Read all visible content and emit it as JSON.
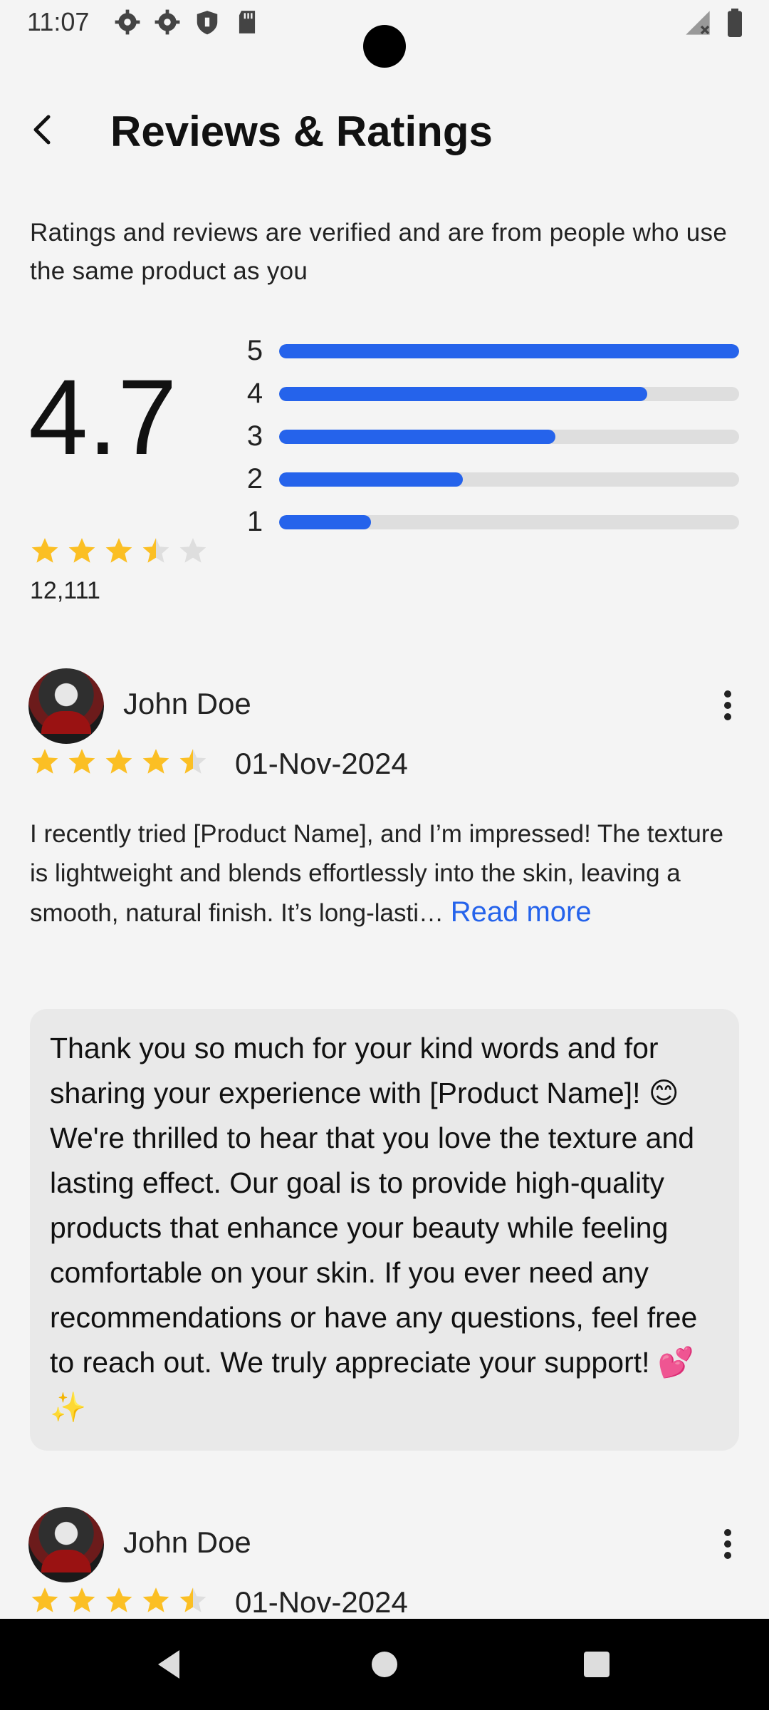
{
  "status_bar": {
    "time": "11:07",
    "icons": [
      "settings-icon",
      "settings-icon",
      "shield-icon",
      "sd-card-icon"
    ],
    "right_icons": [
      "signal-icon",
      "battery-icon"
    ]
  },
  "app_bar": {
    "back_icon": "back-arrow-icon",
    "title": "Reviews & Ratings"
  },
  "intro_text": "Ratings and reviews are verified and are from people who use the same product as you",
  "summary": {
    "average": "4.7",
    "total": "12,111",
    "stars_fraction": 3.5,
    "distribution": [
      {
        "label": "5",
        "fraction": 1.0
      },
      {
        "label": "4",
        "fraction": 0.8
      },
      {
        "label": "3",
        "fraction": 0.6
      },
      {
        "label": "2",
        "fraction": 0.4
      },
      {
        "label": "1",
        "fraction": 0.2
      }
    ],
    "bar_color": "#2563eb"
  },
  "reviews": [
    {
      "name": "John Doe",
      "date": "01-Nov-2024",
      "rating": 4.5,
      "text": "I recently tried [Product Name], and I’m impressed! The texture is lightweight and blends effortlessly into the skin, leaving a smooth, natural finish. It’s long-lasti…",
      "read_more": "Read more",
      "reply": "Thank you so much for your kind words and for sharing your experience with [Product Name]! 😊 We're thrilled to hear that you love the texture and lasting effect. Our goal is to provide high-quality products that enhance your beauty while feeling comfortable on your skin. If you ever need any recommendations or have any questions, feel free to reach out. We truly appreciate your support! 💕✨"
    },
    {
      "name": "John Doe",
      "date": "01-Nov-2024",
      "rating": 4.5
    }
  ],
  "colors": {
    "star": "#fbbf24",
    "star_empty": "#dedede",
    "accent": "#2563eb"
  },
  "nav_bar": [
    "back-triangle-icon",
    "home-circle-icon",
    "recents-square-icon"
  ]
}
